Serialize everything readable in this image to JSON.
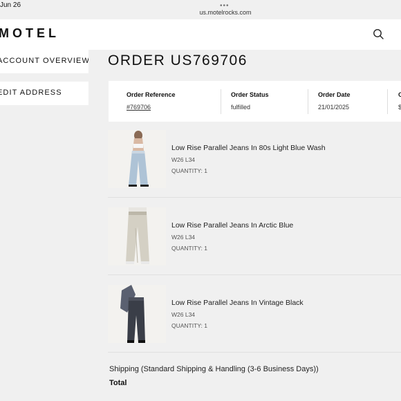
{
  "status_bar": {
    "date": "Jun 26",
    "dots": "•••",
    "url": "us.motelrocks.com"
  },
  "header": {
    "logo": "MOTEL"
  },
  "sidebar": {
    "items": [
      {
        "label": "ACCOUNT OVERVIEW"
      },
      {
        "label": "EDIT ADDRESS"
      }
    ]
  },
  "order": {
    "title": "ORDER US769706",
    "info": [
      {
        "label": "Order Reference",
        "value": "#769706"
      },
      {
        "label": "Order Status",
        "value": "fulfilled"
      },
      {
        "label": "Order Date",
        "value": "21/01/2025"
      },
      {
        "label": "O",
        "value": "$"
      }
    ],
    "items": [
      {
        "name": "Low Rise Parallel Jeans In 80s Light Blue Wash",
        "size": "W26 L34",
        "quantity": "QUANTITY: 1"
      },
      {
        "name": "Low Rise Parallel Jeans In Arctic Blue",
        "size": "W26 L34",
        "quantity": "QUANTITY: 1"
      },
      {
        "name": "Low Rise Parallel Jeans In Vintage Black",
        "size": "W26 L34",
        "quantity": "QUANTITY: 1"
      }
    ],
    "shipping": "Shipping (Standard Shipping & Handling (3-6 Business Days))",
    "total_label": "Total"
  },
  "colors": {
    "background": "#f0f0f0",
    "panel": "#ffffff",
    "text": "#111111",
    "muted": "#555555"
  },
  "icons": {
    "search": "search-icon",
    "thumbnails": [
      "jeans-light-blue-photo",
      "jeans-arctic-blue-photo",
      "jeans-vintage-black-photo"
    ]
  }
}
